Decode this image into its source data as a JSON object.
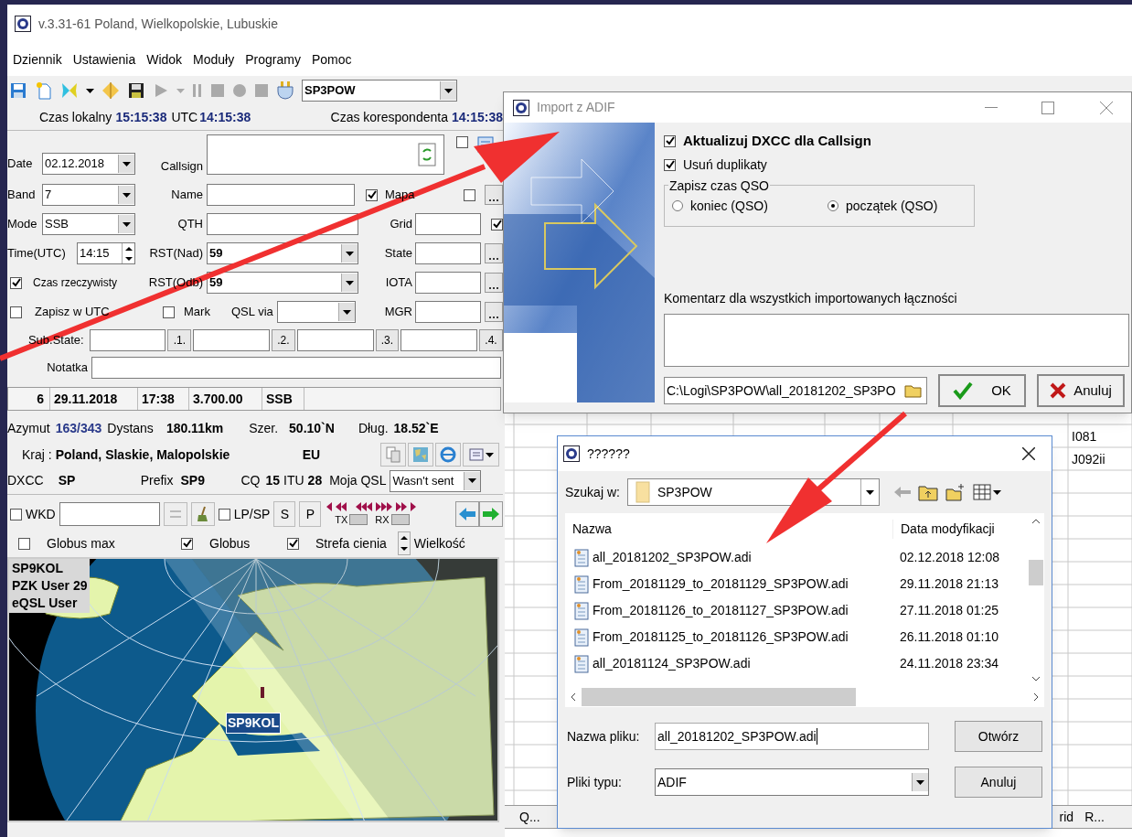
{
  "window": {
    "title": "v.3.31-61 Poland, Wielkopolskie, Lubuskie"
  },
  "menu": [
    "Dziennik",
    "Ustawienia",
    "Widok",
    "Moduły",
    "Programy",
    "Pomoc"
  ],
  "toolbar": {
    "station": "SP3POW"
  },
  "clocks": [
    {
      "label": "Czas lokalny",
      "value": "15:15:38"
    },
    {
      "label": "UTC",
      "value": "14:15:38"
    },
    {
      "label": "Czas korespondenta",
      "value": "14:15:38"
    }
  ],
  "form": {
    "date": {
      "label": "Date",
      "value": "02.12.2018"
    },
    "band": {
      "label": "Band",
      "value": "7"
    },
    "mode": {
      "label": "Mode",
      "value": "SSB"
    },
    "time": {
      "label": "Time(UTC)",
      "value": "14:15"
    },
    "callsign": {
      "label": "Callsign",
      "checked": false
    },
    "name": {
      "label": "Name"
    },
    "qth": {
      "label": "QTH"
    },
    "rst_sent": {
      "label": "RST(Nad)",
      "value": "59"
    },
    "rst_rcvd": {
      "label": "RST(Odb)",
      "value": "59"
    },
    "qsl_via": {
      "label": "QSL via"
    },
    "map_toggle": {
      "label": "Mapa",
      "checked": true,
      "extra_checked": false
    },
    "grid": {
      "label": "Grid",
      "checked": true
    },
    "state": {
      "label": "State"
    },
    "iota": {
      "label": "IOTA"
    },
    "mgr": {
      "label": "MGR"
    },
    "options": [
      {
        "label": "Czas rzeczywisty",
        "checked": true
      },
      {
        "label": "Zapisz w UTC",
        "checked": false
      },
      {
        "label": "Mark",
        "checked": false
      }
    ],
    "sub_state": {
      "label": "Sub.State:",
      "buttons": [
        ".1.",
        ".2.",
        ".3.",
        ".4."
      ]
    },
    "note": {
      "label": "Notatka"
    }
  },
  "last_qso": [
    "6",
    "29.11.2018",
    "17:38",
    "3.700.00",
    "SSB"
  ],
  "info": {
    "azimuth": {
      "label": "Azymut",
      "value": "163/343"
    },
    "distance": {
      "label": "Dystans",
      "value": "180.11km"
    },
    "lat": {
      "label": "Szer.",
      "value": "50.10`N"
    },
    "lon": {
      "label": "Dług.",
      "value": "18.52`E"
    },
    "country": {
      "label": "Kraj :",
      "value": "Poland, Slaskie, Malopolskie"
    },
    "continent": "EU",
    "dxcc": {
      "label": "DXCC",
      "value": "SP"
    },
    "prefix": {
      "label": "Prefix",
      "value": "SP9"
    },
    "cq": {
      "label": "CQ",
      "value": "15"
    },
    "itu": {
      "label": "ITU",
      "value": "28"
    },
    "my_qsl": {
      "label": "Moja QSL",
      "value": "Wasn't sent"
    }
  },
  "wkd": {
    "label": "WKD",
    "checked": false
  },
  "lp_sp": {
    "label": "LP/SP",
    "checked": false
  },
  "sp_buttons": [
    "S",
    "P"
  ],
  "tx_rx": [
    "TX",
    "RX"
  ],
  "globe_options": [
    {
      "label": "Globus max",
      "checked": false
    },
    {
      "label": "Globus",
      "checked": true
    },
    {
      "label": "Strefa cienia",
      "checked": true
    }
  ],
  "size_label": "Wielkość",
  "map": {
    "overlay": [
      "SP9KOL",
      "PZK User 29",
      "eQSL User"
    ],
    "marker": "SP9KOL"
  },
  "log_table": {
    "cells": [
      "I081",
      "J092ii"
    ],
    "headers": [
      "Q...",
      "rid",
      "R..."
    ]
  },
  "import_dialog": {
    "title": "Import z ADIF",
    "options": [
      {
        "label": "Aktualizuj DXCC dla Callsign",
        "checked": true
      },
      {
        "label": "Usuń duplikaty",
        "checked": true
      }
    ],
    "time_group": {
      "label": "Zapisz czas QSO",
      "choices": [
        {
          "label": "koniec (QSO)",
          "selected": false
        },
        {
          "label": "początek (QSO)",
          "selected": true
        }
      ]
    },
    "comment_label": "Komentarz dla wszystkich importowanych łączności",
    "path": "C:\\Logi\\SP3POW\\all_20181202_SP3PO",
    "buttons": [
      "OK",
      "Anuluj"
    ]
  },
  "file_dialog": {
    "title": "??????",
    "look_in_label": "Szukaj w:",
    "look_in": "SP3POW",
    "columns": [
      "Nazwa",
      "Data modyfikacji"
    ],
    "files": [
      {
        "name": "all_20181202_SP3POW.adi",
        "date": "02.12.2018 12:08"
      },
      {
        "name": "From_20181129_to_20181129_SP3POW.adi",
        "date": "29.11.2018 21:13"
      },
      {
        "name": "From_20181126_to_20181127_SP3POW.adi",
        "date": "27.11.2018 01:25"
      },
      {
        "name": "From_20181125_to_20181126_SP3POW.adi",
        "date": "26.11.2018 01:10"
      },
      {
        "name": "all_20181124_SP3POW.adi",
        "date": "24.11.2018 23:34"
      }
    ],
    "filename_label": "Nazwa pliku:",
    "filename": "all_20181202_SP3POW.adi",
    "type_label": "Pliki typu:",
    "type": "ADIF",
    "buttons": [
      "Otwórz",
      "Anuluj"
    ]
  }
}
